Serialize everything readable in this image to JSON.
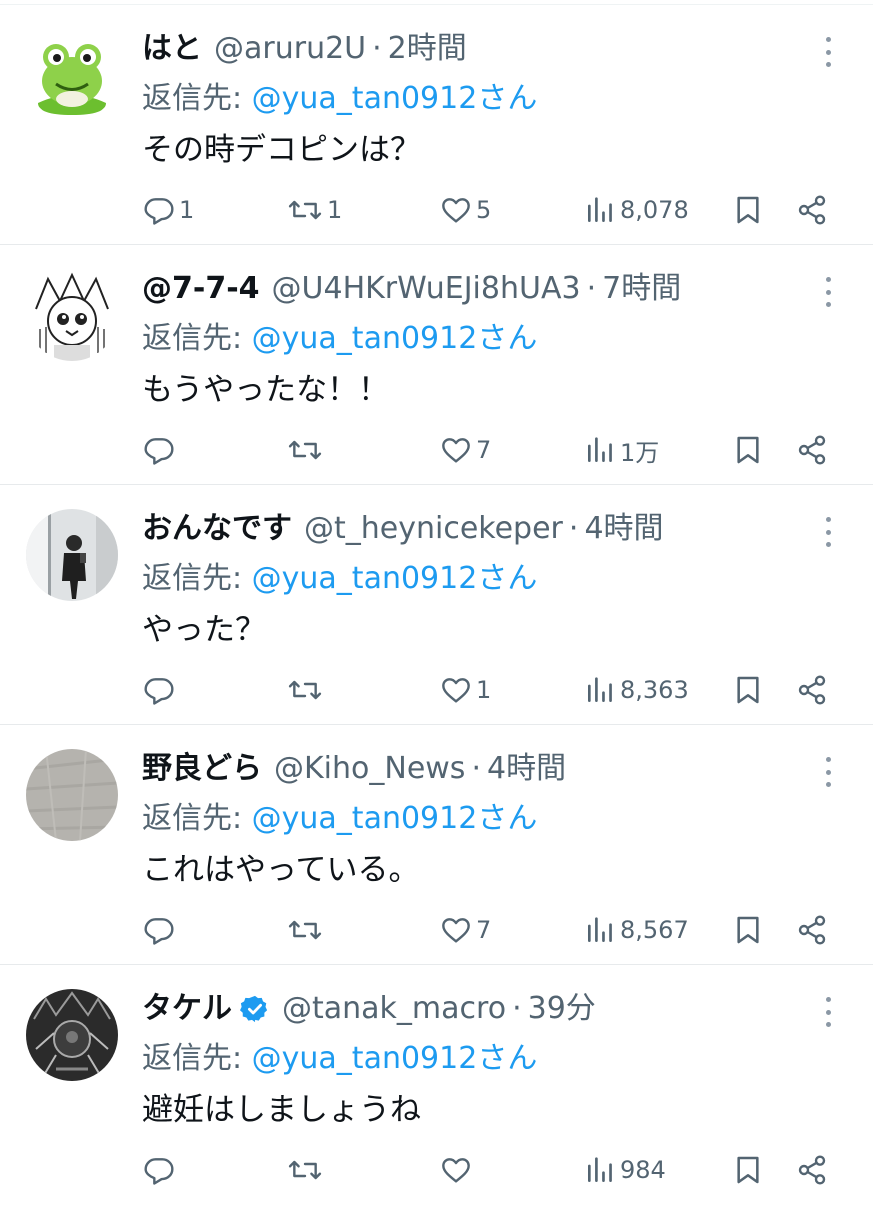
{
  "reply_prefix": "返信先: ",
  "tweets": [
    {
      "name": "はと",
      "verified": false,
      "handle": "@aruru2U",
      "separator": "·",
      "time": "2時間",
      "reply_to": "@yua_tan0912さん",
      "text": "その時デコピンは？",
      "replies": "1",
      "retweets": "1",
      "likes": "5",
      "views": "8,078",
      "avatar": "frog-avatar"
    },
    {
      "name": "@7-7-4",
      "verified": false,
      "handle": "@U4HKrWuEJi8hUA3",
      "separator": "·",
      "time": "7時間",
      "reply_to": "@yua_tan0912さん",
      "text": "もうやったな！！",
      "replies": "",
      "retweets": "",
      "likes": "7",
      "views": "1万",
      "avatar": "manga-avatar"
    },
    {
      "name": "おんなです",
      "verified": false,
      "handle": "@t_heynicekeper",
      "separator": "·",
      "time": "4時間",
      "reply_to": "@yua_tan0912さん",
      "text": "やった？",
      "replies": "",
      "retweets": "",
      "likes": "1",
      "views": "8,363",
      "avatar": "mirror-selfie-avatar"
    },
    {
      "name": "野良どら",
      "verified": false,
      "handle": "@Kiho_News",
      "separator": "·",
      "time": "4時間",
      "reply_to": "@yua_tan0912さん",
      "text": "これはやっている。",
      "replies": "",
      "retweets": "",
      "likes": "7",
      "views": "8,567",
      "avatar": "gray-texture-avatar"
    },
    {
      "name": "タケル",
      "verified": true,
      "handle": "@tanak_macro",
      "separator": "·",
      "time": "39分",
      "reply_to": "@yua_tan0912さん",
      "text": "避妊はしましょうね",
      "replies": "",
      "retweets": "",
      "likes": "",
      "views": "984",
      "avatar": "dark-art-avatar"
    }
  ],
  "colors": {
    "text_primary": "#0f1419",
    "text_secondary": "#536471",
    "link_blue": "#1d9bf0",
    "divider": "#e7eaec"
  }
}
